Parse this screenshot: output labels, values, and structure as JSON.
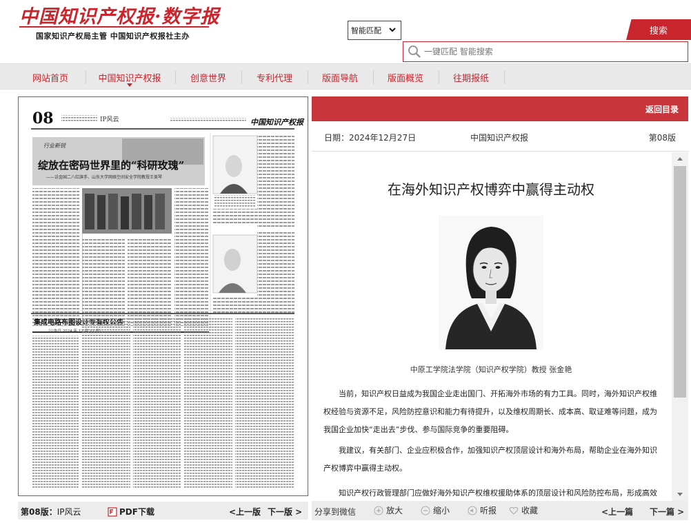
{
  "header": {
    "logo_title": "中国知识产权报·数字报",
    "logo_sub": "国家知识产权局主管  中国知识产权报社主办",
    "match_select": "智能匹配",
    "search_button": "搜索",
    "search_placeholder": "一键匹配 智能搜索"
  },
  "nav": {
    "items": [
      {
        "label": "网站首页"
      },
      {
        "label": "中国知识产权报"
      },
      {
        "label": "创意世界"
      },
      {
        "label": "专利代理"
      },
      {
        "label": "版面导航"
      },
      {
        "label": "版面概览"
      },
      {
        "label": "往期报纸"
      }
    ],
    "active_index": 1
  },
  "paper": {
    "page_number": "08",
    "section_name": "IP风云",
    "masthead": "中国知识产权报",
    "headline": "绽放在密码世界里的“科研玫瑰”",
    "subheadline": "——访金国二八红旗手、山东大学网络空间安全学院教授王美琴",
    "column_tag": "行业新锐",
    "notice_title": "集成电路布图设计专有权公告",
    "notice_date": "（公告日 2024 年 12 月 27 日）"
  },
  "left_footer": {
    "page_label": "第08版：",
    "page_name": "IP风云",
    "pdf_label": "PDF下载",
    "prev": "<上一版",
    "next": "下一版 >"
  },
  "article": {
    "back_label": "返回目录",
    "date_text": "日期：2024年12月27日",
    "publication": "中国知识产权报",
    "page_text": "第08版",
    "title": "在海外知识产权博弈中赢得主动权",
    "caption": "中原工学院法学院（知识产权学院）教授 张金艳",
    "paragraphs": [
      "当前，知识产权日益成为我国企业走出国门、开拓海外市场的有力工具。同时，海外知识产权维权经验与资源不足，风险防控意识和能力有待提升，以及维权周期长、成本高、取证难等问题，成为我国企业加快“走出去”步伐、参与国际竞争的重要阻碍。",
      "我建议，有关部门、企业应积极合作，加强知识产权顶层设计和海外布局，帮助企业在海外知识产权博弈中赢得主动权。",
      "知识产权行政管理部门应做好海外知识产权维权援助体系的顶层设计和风险防控布局，形成高效的"
    ]
  },
  "right_footer": {
    "share": "分享到微信",
    "zoom_in": "放大",
    "zoom_out": "缩小",
    "listen": "听报",
    "favorite": "收藏",
    "prev": "<上一篇",
    "next": "下一篇 >"
  },
  "colors": {
    "brand_red": "#c8252c",
    "bar_red": "#c8363c",
    "nav_bg": "#e9e9e9"
  }
}
